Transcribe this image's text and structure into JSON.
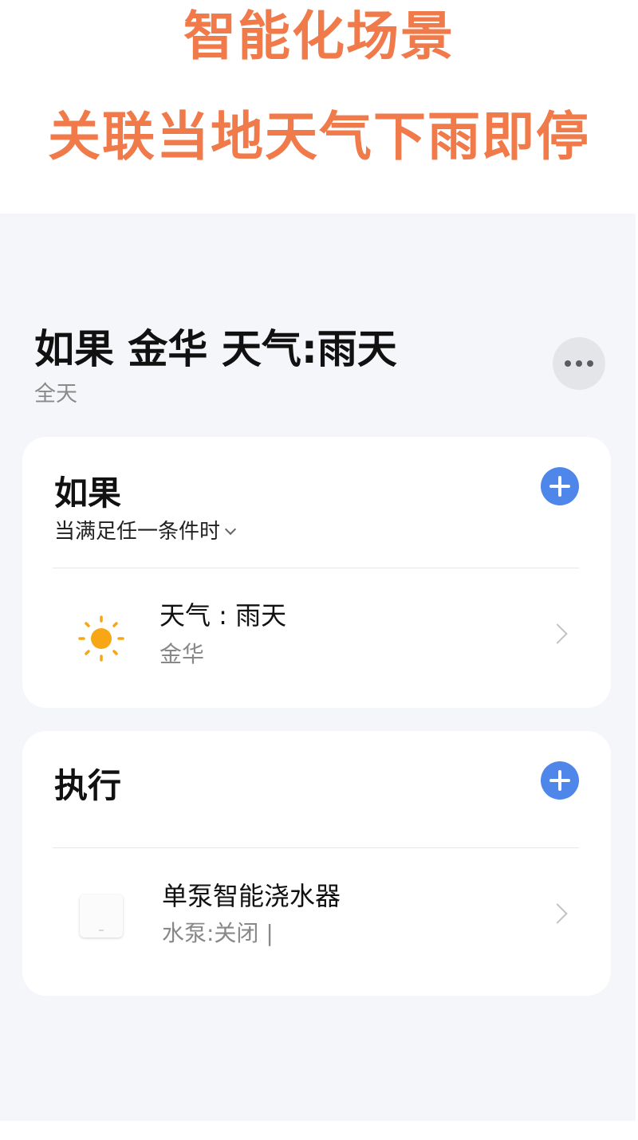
{
  "banner": {
    "line1": "智能化场景",
    "line2": "关联当地天气下雨即停"
  },
  "scene": {
    "title": "如果 金华 天气:雨天",
    "subtitle": "全天"
  },
  "if_card": {
    "title": "如果",
    "condition_mode": "当满足任一条件时",
    "items": [
      {
        "icon": "sun-icon",
        "title": "天气 : 雨天",
        "subtitle": "金华"
      }
    ]
  },
  "exec_card": {
    "title": "执行",
    "items": [
      {
        "icon": "water-pump-device-icon",
        "title": "单泵智能浇水器",
        "subtitle": "水泵:关闭 |"
      }
    ]
  },
  "colors": {
    "banner_text": "#f07a4a",
    "accent_blue": "#4e86ea",
    "sun": "#f7a616",
    "background": "#f5f6fa"
  }
}
